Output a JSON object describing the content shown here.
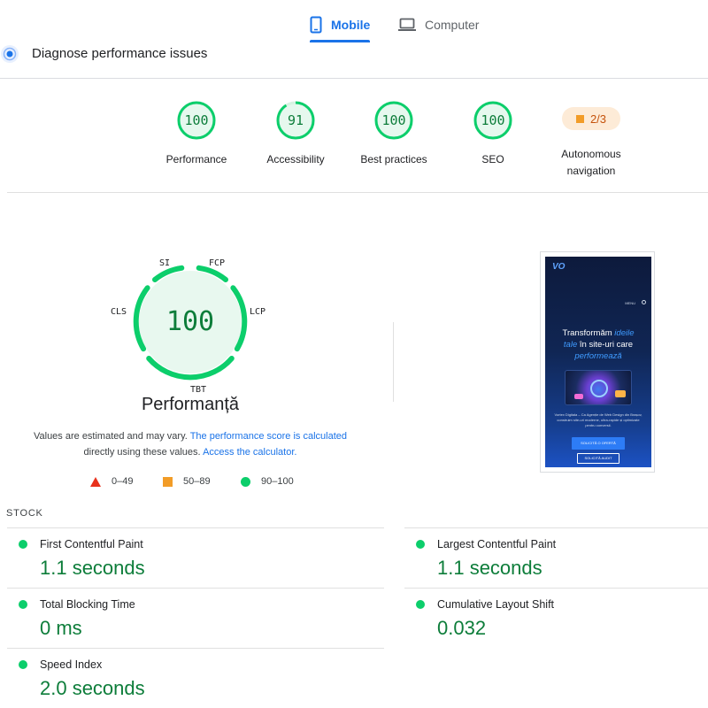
{
  "tabs": [
    {
      "label": "Mobile",
      "active": true,
      "icon": "smartphone-icon"
    },
    {
      "label": "Computer",
      "active": false,
      "icon": "laptop-icon"
    }
  ],
  "diagnose": {
    "title": "Diagnose performance issues",
    "icon": "lighthouse-icon"
  },
  "categories": [
    {
      "score": "100",
      "label": "Performance",
      "fraction": 1.0
    },
    {
      "score": "91",
      "label": "Accessibility",
      "fraction": 0.91
    },
    {
      "score": "100",
      "label": "Best practices",
      "fraction": 1.0
    },
    {
      "score": "100",
      "label": "SEO",
      "fraction": 1.0
    }
  ],
  "autonomous": {
    "badge": "2/3",
    "label_line1": "Autonomous",
    "label_line2": "navigation"
  },
  "gauge": {
    "score": "100",
    "title": "Performanță",
    "labels": {
      "si": "SI",
      "fcp": "FCP",
      "lcp": "LCP",
      "tbt": "TBT",
      "cls": "CLS"
    }
  },
  "note": {
    "text1": "Values are estimated and may vary.",
    "link1": "The performance score is calculated",
    "text2": "directly using these values.",
    "link2": "Access the calculator."
  },
  "legend": {
    "poor": "0–49",
    "average": "50–89",
    "good": "90–100"
  },
  "screenshot": {
    "logo": "VO",
    "nav": "MENU",
    "headline_pre": "Transformăm",
    "headline_hl1": "ideile",
    "headline_hl2": "tale",
    "headline_mid": "în site-uri care",
    "headline_hl3": "performează",
    "paragraph": "Vortex Digitala – Ca Agenție de Web Design din Brașov, construim site-uri moderne, ultra-rapide și optimizate pentru conversii.",
    "button1": "SOLICITĂ O OFERTĂ",
    "button2": "SOLICITĂ AUDIT"
  },
  "metrics": {
    "title": "STOCK",
    "items": [
      {
        "name": "First Contentful Paint",
        "value": "1.1 seconds"
      },
      {
        "name": "Largest Contentful Paint",
        "value": "1.1 seconds"
      },
      {
        "name": "Total Blocking Time",
        "value": "0 ms"
      },
      {
        "name": "Cumulative Layout Shift",
        "value": "0.032"
      },
      {
        "name": "Speed Index",
        "value": "2.0 seconds"
      }
    ]
  },
  "colors": {
    "good": "#0cce6b",
    "good_text": "#0d7d3a",
    "average": "#f29c27",
    "poor": "#e8311c",
    "accent": "#1a73e8"
  }
}
